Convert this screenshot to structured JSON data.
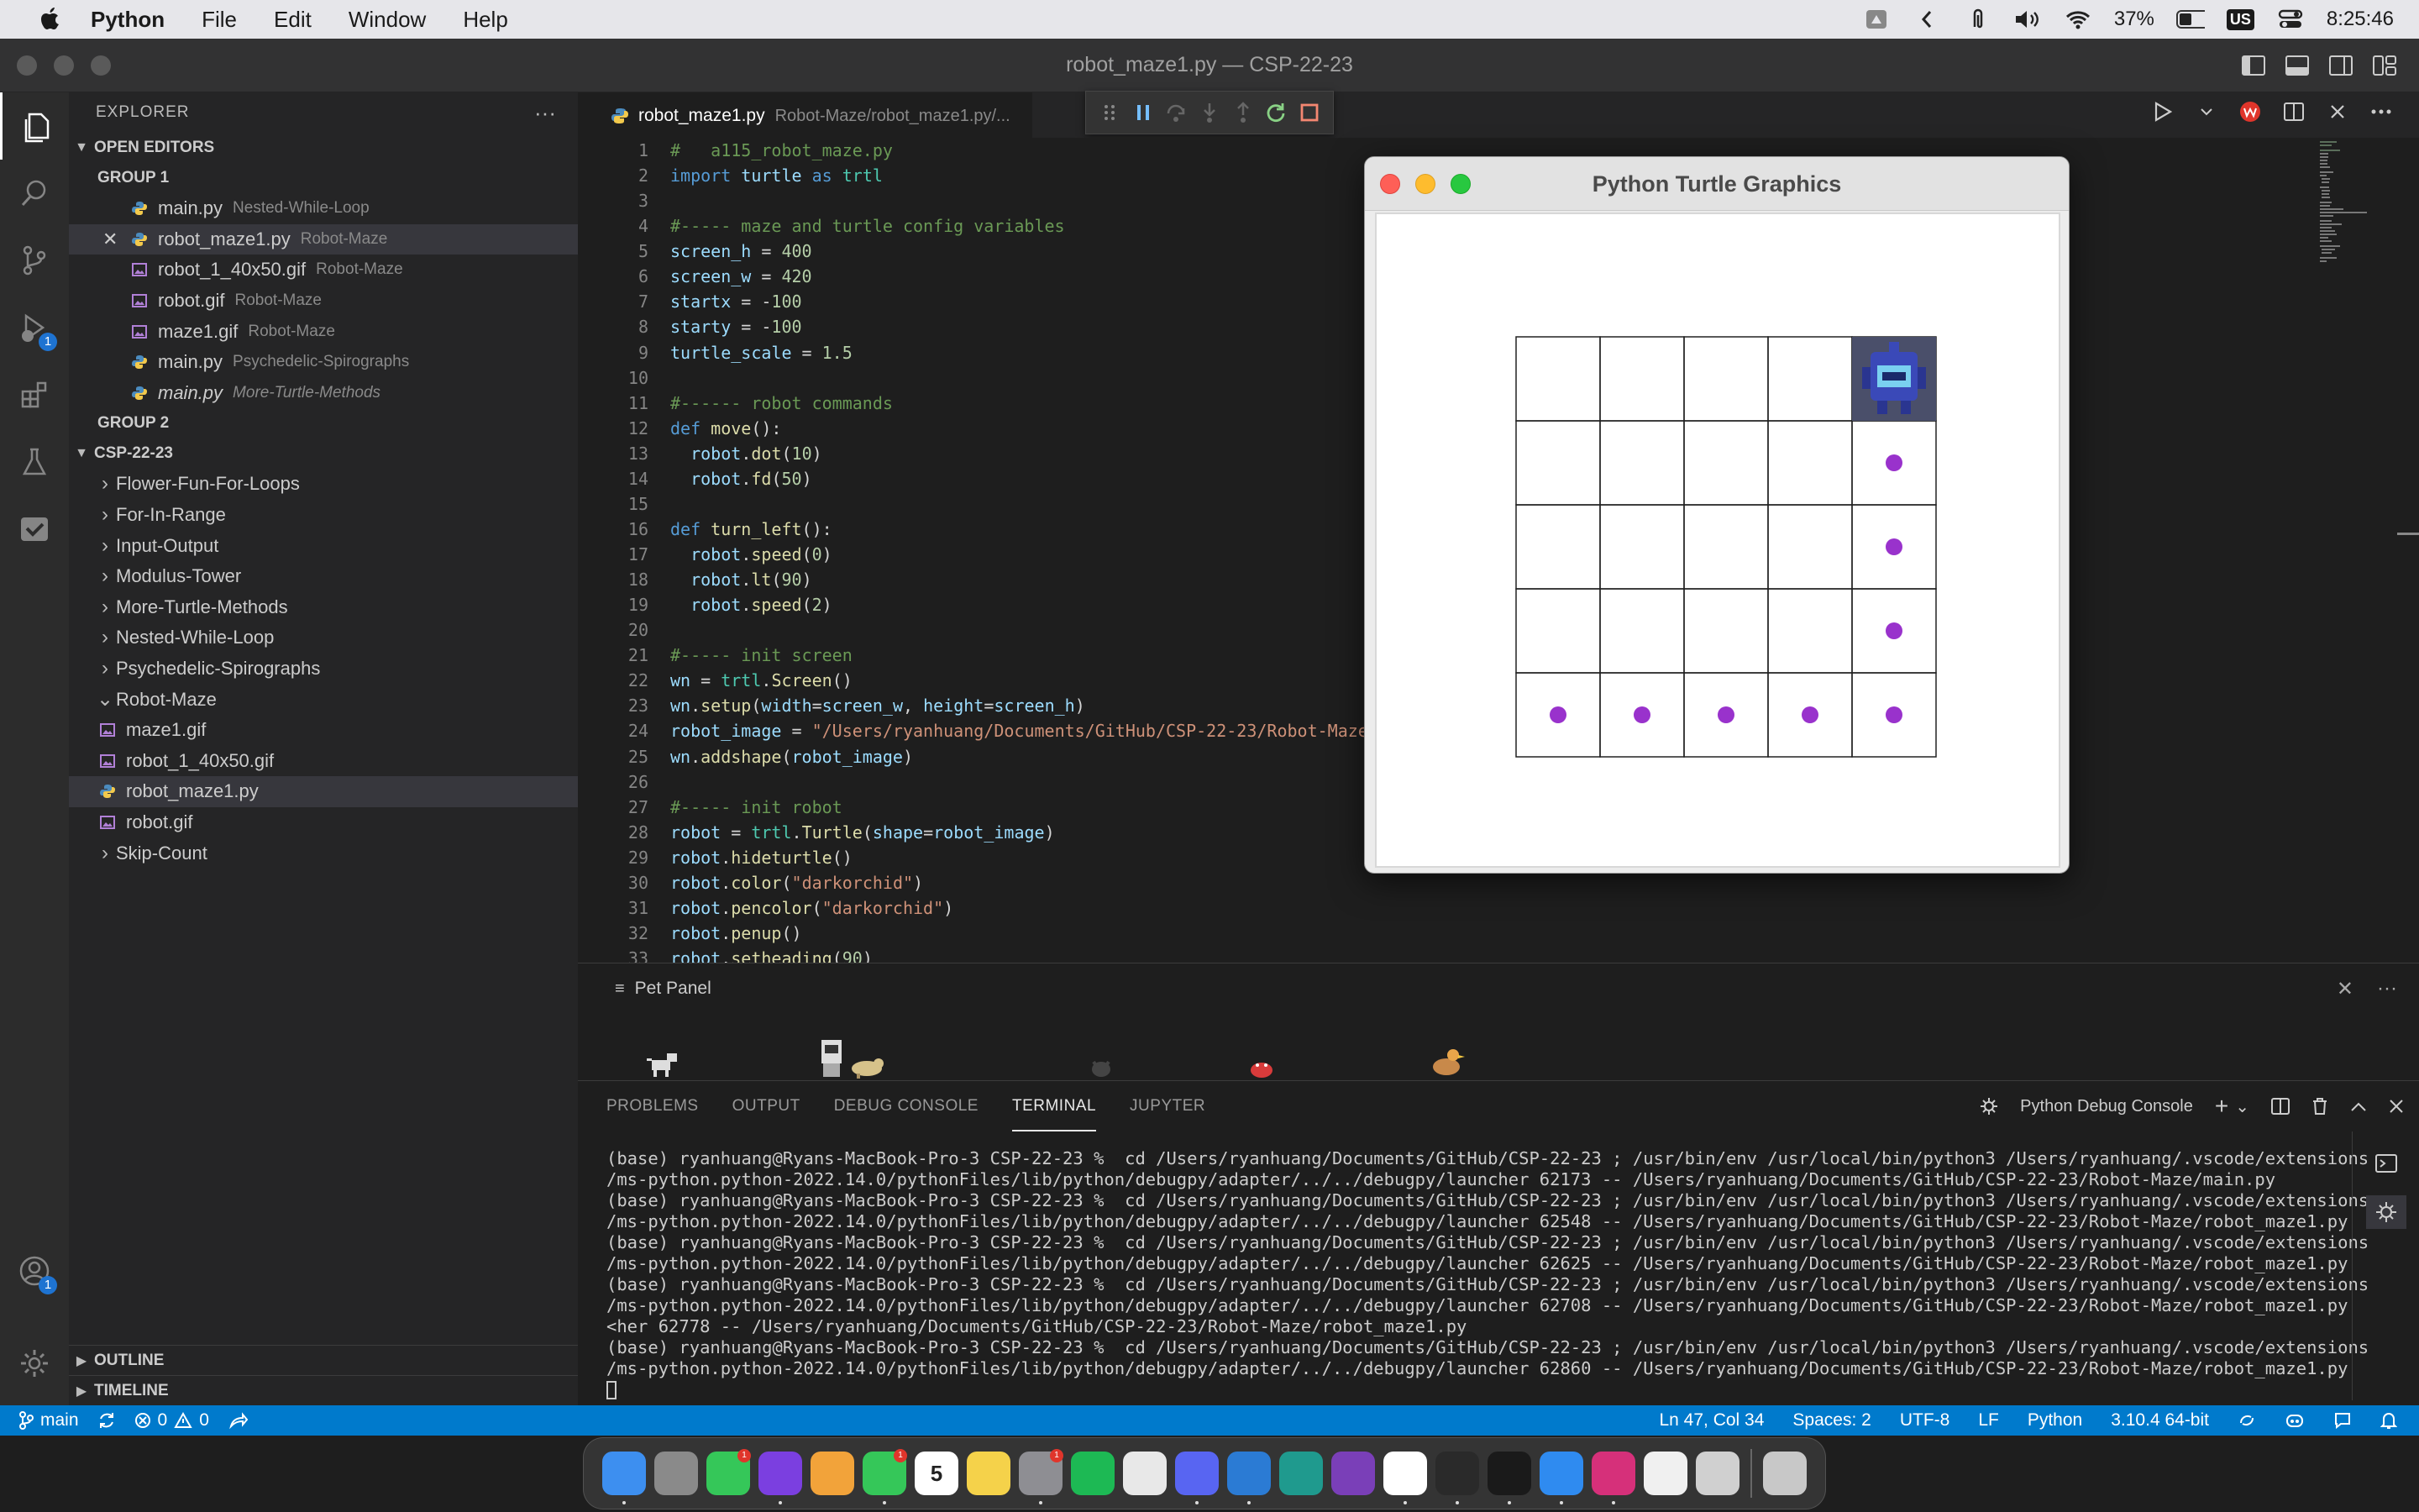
{
  "menubar": {
    "app": "Python",
    "items": [
      "File",
      "Edit",
      "Window",
      "Help"
    ],
    "battery": "37%",
    "input_source": "US",
    "clock": "8:25:46"
  },
  "window": {
    "title": "robot_maze1.py — CSP-22-23"
  },
  "activity_bar": {
    "items": [
      {
        "icon": "files-icon"
      },
      {
        "icon": "search-icon"
      },
      {
        "icon": "source-control-icon"
      },
      {
        "icon": "run-debug-icon",
        "badge": "1"
      },
      {
        "icon": "extensions-icon"
      },
      {
        "icon": "testing-icon"
      },
      {
        "icon": "check-icon"
      }
    ],
    "accounts_badge": "1"
  },
  "explorer": {
    "title": "EXPLORER",
    "more": "···",
    "open_editors": {
      "label": "OPEN EDITORS",
      "group1": "GROUP 1",
      "files": [
        {
          "name": "main.py",
          "desc": "Nested-While-Loop",
          "type": "py"
        },
        {
          "name": "robot_maze1.py",
          "desc": "Robot-Maze",
          "type": "py"
        },
        {
          "name": "robot_1_40x50.gif",
          "desc": "Robot-Maze",
          "type": "gif"
        },
        {
          "name": "robot.gif",
          "desc": "Robot-Maze",
          "type": "gif"
        },
        {
          "name": "maze1.gif",
          "desc": "Robot-Maze",
          "type": "gif"
        },
        {
          "name": "main.py",
          "desc": "Psychedelic-Spirographs",
          "type": "py"
        },
        {
          "name": "main.py",
          "desc": "More-Turtle-Methods",
          "type": "py"
        }
      ],
      "group2": "GROUP 2"
    },
    "workspace": {
      "label": "CSP-22-23",
      "folders": [
        "Flower-Fun-For-Loops",
        "For-In-Range",
        "Input-Output",
        "Modulus-Tower",
        "More-Turtle-Methods",
        "Nested-While-Loop",
        "Psychedelic-Spirographs"
      ],
      "open_folder": "Robot-Maze",
      "open_folder_files": [
        "maze1.gif",
        "robot_1_40x50.gif",
        "robot_maze1.py",
        "robot.gif"
      ],
      "after_folder": "Skip-Count"
    },
    "outline": "OUTLINE",
    "timeline": "TIMELINE"
  },
  "tab": {
    "name": "robot_maze1.py",
    "path": "Robot-Maze/robot_maze1.py/..."
  },
  "code": {
    "line_numbers": [
      "1",
      "2",
      "3",
      "4",
      "5",
      "6",
      "7",
      "8",
      "9",
      "10",
      "11",
      "12",
      "13",
      "14",
      "15",
      "16",
      "17",
      "18",
      "19",
      "20",
      "21",
      "22",
      "23",
      "24",
      "25",
      "26",
      "27",
      "28",
      "29",
      "30",
      "31",
      "32",
      "33"
    ],
    "lines": [
      "#   a115_robot_maze.py",
      "import turtle as trtl",
      "",
      "#----- maze and turtle config variables",
      "screen_h = 400",
      "screen_w = 420",
      "startx = -100",
      "starty = -100",
      "turtle_scale = 1.5",
      "",
      "#------ robot commands",
      "def move():",
      "  robot.dot(10)",
      "  robot.fd(50)",
      "",
      "def turn_left():",
      "  robot.speed(0)",
      "  robot.lt(90)",
      "  robot.speed(2)",
      "",
      "#----- init screen",
      "wn = trtl.Screen()",
      "wn.setup(width=screen_w, height=screen_h)",
      "robot_image = \"/Users/ryanhuang/Documents/GitHub/CSP-22-23/Robot-Maze",
      "wn.addshape(robot_image)",
      "",
      "#----- init robot",
      "robot = trtl.Turtle(shape=robot_image)",
      "robot.hideturtle()",
      "robot.color(\"darkorchid\")",
      "robot.pencolor(\"darkorchid\")",
      "robot.penup()",
      "robot.setheading(90)"
    ]
  },
  "turtle_window": {
    "title": "Python Turtle Graphics",
    "grid_rows": 5,
    "grid_cols": 5,
    "dot_color": "#9932cc",
    "robot_cell": {
      "row": 0,
      "col": 4
    },
    "dots": [
      [
        1,
        4
      ],
      [
        2,
        4
      ],
      [
        3,
        4
      ],
      [
        4,
        0
      ],
      [
        4,
        1
      ],
      [
        4,
        2
      ],
      [
        4,
        3
      ],
      [
        4,
        4
      ]
    ]
  },
  "pet_panel": {
    "title": "Pet Panel"
  },
  "terminal": {
    "tabs": [
      "PROBLEMS",
      "OUTPUT",
      "DEBUG CONSOLE",
      "TERMINAL",
      "JUPYTER"
    ],
    "active_tab": "TERMINAL",
    "profile": "Python Debug Console",
    "lines": [
      "(base) ryanhuang@Ryans-MacBook-Pro-3 CSP-22-23 %  cd /Users/ryanhuang/Documents/GitHub/CSP-22-23 ; /usr/bin/env /usr/local/bin/python3 /Users/ryanhuang/.vscode/extensions",
      "/ms-python.python-2022.14.0/pythonFiles/lib/python/debugpy/adapter/../../debugpy/launcher 62173 -- /Users/ryanhuang/Documents/GitHub/CSP-22-23/Robot-Maze/main.py",
      "(base) ryanhuang@Ryans-MacBook-Pro-3 CSP-22-23 %  cd /Users/ryanhuang/Documents/GitHub/CSP-22-23 ; /usr/bin/env /usr/local/bin/python3 /Users/ryanhuang/.vscode/extensions",
      "/ms-python.python-2022.14.0/pythonFiles/lib/python/debugpy/adapter/../../debugpy/launcher 62548 -- /Users/ryanhuang/Documents/GitHub/CSP-22-23/Robot-Maze/robot_maze1.py",
      "(base) ryanhuang@Ryans-MacBook-Pro-3 CSP-22-23 %  cd /Users/ryanhuang/Documents/GitHub/CSP-22-23 ; /usr/bin/env /usr/local/bin/python3 /Users/ryanhuang/.vscode/extensions",
      "/ms-python.python-2022.14.0/pythonFiles/lib/python/debugpy/adapter/../../debugpy/launcher 62625 -- /Users/ryanhuang/Documents/GitHub/CSP-22-23/Robot-Maze/robot_maze1.py",
      "(base) ryanhuang@Ryans-MacBook-Pro-3 CSP-22-23 %  cd /Users/ryanhuang/Documents/GitHub/CSP-22-23 ; /usr/bin/env /usr/local/bin/python3 /Users/ryanhuang/.vscode/extensions",
      "/ms-python.python-2022.14.0/pythonFiles/lib/python/debugpy/adapter/../../debugpy/launcher 62708 -- /Users/ryanhuang/Documents/GitHub/CSP-22-23/Robot-Maze/robot_maze1.py",
      "<her 62778 -- /Users/ryanhuang/Documents/GitHub/CSP-22-23/Robot-Maze/robot_maze1.py",
      "(base) ryanhuang@Ryans-MacBook-Pro-3 CSP-22-23 %  cd /Users/ryanhuang/Documents/GitHub/CSP-22-23 ; /usr/bin/env /usr/local/bin/python3 /Users/ryanhuang/.vscode/extensions",
      "/ms-python.python-2022.14.0/pythonFiles/lib/python/debugpy/adapter/../../debugpy/launcher 62860 -- /Users/ryanhuang/Documents/GitHub/CSP-22-23/Robot-Maze/robot_maze1.py"
    ]
  },
  "statusbar": {
    "branch": "main",
    "errors": "0",
    "warnings": "0",
    "position": "Ln 47, Col 34",
    "spaces": "Spaces: 2",
    "encoding": "UTF-8",
    "eol": "LF",
    "language": "Python",
    "interpreter": "3.10.4 64-bit",
    "color": "#007acc"
  },
  "dock": {
    "apps": [
      {
        "icon": "finder-icon",
        "color": "#3d8ff0"
      },
      {
        "icon": "launchpad-icon",
        "color": "#8a8a8a"
      },
      {
        "icon": "facetime-icon",
        "color": "#35c759",
        "badge": "1"
      },
      {
        "icon": "safari-tp-icon",
        "color": "#7b3fe0"
      },
      {
        "icon": "photos-icon",
        "color": "#f2a33a"
      },
      {
        "icon": "messages-icon",
        "color": "#35c759",
        "badge": "1"
      },
      {
        "icon": "calendar-icon",
        "color": "#ffffff",
        "label": "5"
      },
      {
        "icon": "notes-icon",
        "color": "#f5d24a"
      },
      {
        "icon": "system-preferences-icon",
        "color": "#8e8e93",
        "badge": "1"
      },
      {
        "icon": "spotify-icon",
        "color": "#1db954"
      },
      {
        "icon": "chrome-icon",
        "color": "#e8e8e8"
      },
      {
        "icon": "discord-icon",
        "color": "#5865f2"
      },
      {
        "icon": "vscode-icon",
        "color": "#2b7bd4"
      },
      {
        "icon": "vscode-insiders-icon",
        "color": "#1f9a8e"
      },
      {
        "icon": "github-desktop-icon",
        "color": "#7a3fb8"
      },
      {
        "icon": "slack-icon",
        "color": "#ffffff"
      },
      {
        "icon": "terminal-icon",
        "color": "#2a2a2a"
      },
      {
        "icon": "activity-monitor-icon",
        "color": "#1a1a1a"
      },
      {
        "icon": "safari-icon",
        "color": "#2f8bf0"
      },
      {
        "icon": "instagram-icon",
        "color": "#d6307a"
      },
      {
        "icon": "tux-icon",
        "color": "#f0f0f0"
      },
      {
        "icon": "rocket-icon",
        "color": "#d0d0d0"
      },
      {
        "icon": "trash-icon",
        "color": "#c8c8c8"
      }
    ]
  }
}
